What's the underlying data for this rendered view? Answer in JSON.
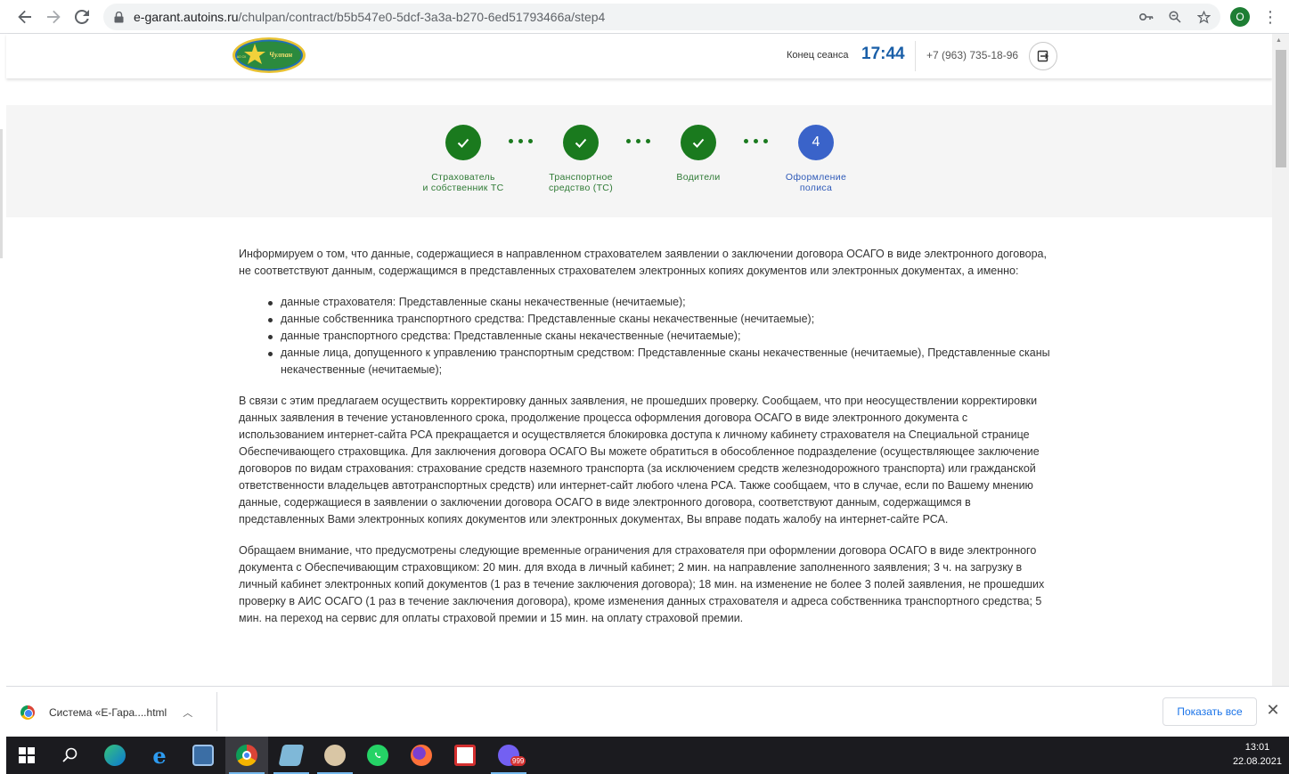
{
  "browser": {
    "url_host": "e-garant.autoins.ru",
    "url_path": "/chulpan/contract/b5b547e0-5dcf-3a3a-b270-6ed51793466a/step4",
    "profile_initial": "O"
  },
  "header": {
    "logo_text": "Чулпан",
    "logo_subtext": "АО СК",
    "session_label": "Конец сеанса",
    "session_time": "17:44",
    "phone": "+7 (963) 735-18-96"
  },
  "steps": [
    {
      "label_line1": "Страхователь",
      "label_line2": "и собственник ТС",
      "status": "done"
    },
    {
      "label_line1": "Транспортное",
      "label_line2": "средство (ТС)",
      "status": "done"
    },
    {
      "label_line1": "Водители",
      "label_line2": "",
      "status": "done"
    },
    {
      "label_line1": "Оформление",
      "label_line2": "полиса",
      "status": "active",
      "number": "4"
    }
  ],
  "content": {
    "intro": "Информируем о том, что данные, содержащиеся в направленном страхователем заявлении о заключении договора ОСАГО в виде электронного договора, не соответствуют данным, содержащимся в представленных страхователем электронных копиях документов или электронных документах, а именно:",
    "items": [
      "данные страхователя: Представленные сканы некачественные (нечитаемые);",
      "данные собственника транспортного средства: Представленные сканы некачественные (нечитаемые);",
      "данные транспортного средства: Представленные сканы некачественные (нечитаемые);",
      "данные лица, допущенного к управлению транспортным средством: Представленные сканы некачественные (нечитаемые), Представленные сканы некачественные (нечитаемые);"
    ],
    "paragraph2": "В связи с этим предлагаем осуществить корректировку данных заявления, не прошедших проверку. Сообщаем, что при неосуществлении корректировки данных заявления в течение установленного срока, продолжение процесса оформления договора ОСАГО в виде электронного документа с использованием интернет-сайта РСА прекращается и осуществляется блокировка доступа к личному кабинету страхователя на Специальной странице Обеспечивающего страховщика. Для заключения договора ОСАГО Вы можете обратиться в обособленное подразделение (осуществляющее заключение договоров по видам страхования: страхование средств наземного транспорта (за исключением средств железнодорожного транспорта) или гражданской ответственности владельцев автотранспортных средств) или интернет-сайт любого члена РСА. Также сообщаем, что в случае, если по Вашему мнению данные, содержащиеся в заявлении о заключении договора ОСАГО в виде электронного договора, соответствуют данным, содержащимся в представленных Вами электронных копиях документов или электронных документах, Вы вправе подать жалобу на интернет-сайте РСА.",
    "paragraph3": "Обращаем внимание, что предусмотрены следующие временные ограничения для страхователя при оформлении договора ОСАГО в виде электронного документа с Обеспечивающим страховщиком: 20 мин. для входа в личный кабинет; 2 мин. на направление заполненного заявления; 3 ч. на загрузку в личный кабинет электронных копий документов (1 раз в течение заключения договора); 18 мин. на изменение не более 3 полей заявления, не прошедших проверку в АИС ОСАГО (1 раз в течение заключения договора), кроме изменения данных страхователя и адреса собственника транспортного средства; 5 мин. на переход на сервис для оплаты страховой премии и 15 мин. на оплату страховой премии."
  },
  "download_bar": {
    "file_name": "Система «Е-Гара....html",
    "show_all": "Показать все"
  },
  "taskbar": {
    "time": "13:01",
    "date": "22.08.2021",
    "viber_badge": "999"
  },
  "colors": {
    "done": "#1a7a1e",
    "active": "#3a63c9",
    "session_time": "#1a5fa8"
  }
}
